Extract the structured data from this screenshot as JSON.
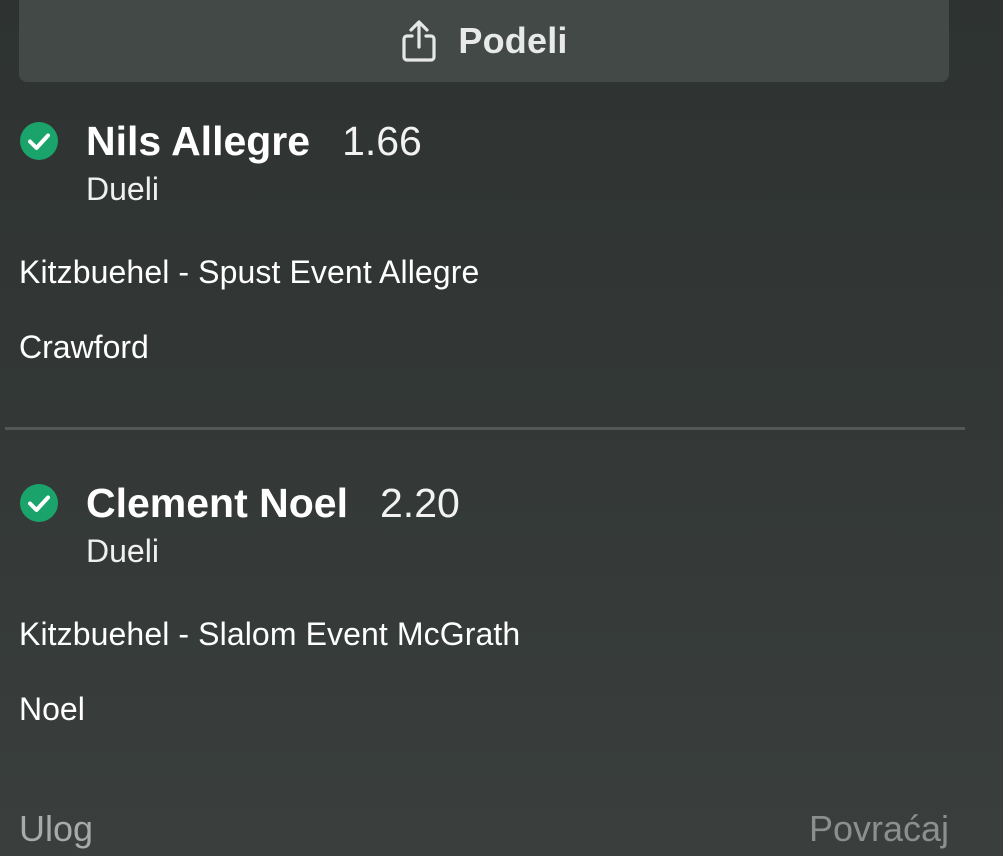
{
  "share": {
    "label": "Podeli",
    "icon": "share-icon"
  },
  "legs": [
    {
      "status_icon": "check-circle-icon",
      "status_color": "#1aa36a",
      "selection": "Nils Allegre",
      "odds": "1.66",
      "market": "Dueli",
      "event": "Kitzbuehel - Spust Event Allegre",
      "sub": "Crawford"
    },
    {
      "status_icon": "check-circle-icon",
      "status_color": "#1aa36a",
      "selection": "Clement Noel",
      "odds": "2.20",
      "market": "Dueli",
      "event": "Kitzbuehel - Slalom Event McGrath",
      "sub": "Noel"
    }
  ],
  "footer": {
    "stake_label": "Ulog",
    "return_label": "Povraćaj"
  }
}
